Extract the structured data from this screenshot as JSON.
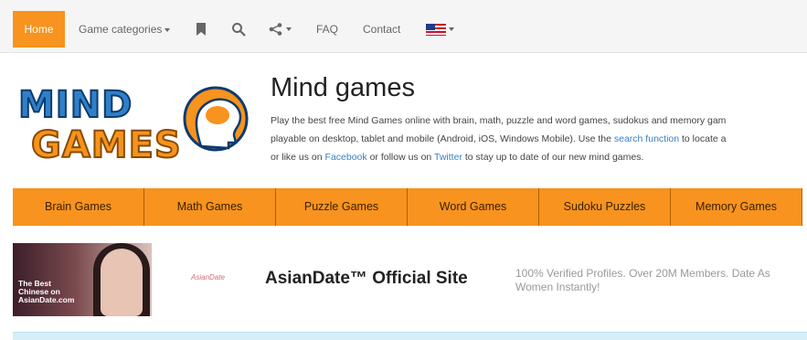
{
  "nav": {
    "home": "Home",
    "categories": "Game categories",
    "faq": "FAQ",
    "contact": "Contact",
    "icons": [
      "bookmark-icon",
      "search-icon",
      "share-icon",
      "us-flag-icon"
    ]
  },
  "logo": {
    "line1": "MIND",
    "line2": "GAMES"
  },
  "header": {
    "title": "Mind games",
    "desc_line1": "Play the best free Mind Games online with brain, math, puzzle and word games, sudokus and memory gam",
    "desc_line2_a": "playable on desktop, tablet and mobile (Android, iOS, Windows Mobile). Use the ",
    "desc_line2_link": "search function",
    "desc_line2_b": " to locate a",
    "desc_line3_a": "or like us on ",
    "desc_line3_link1": "Facebook",
    "desc_line3_b": " or follow us on ",
    "desc_line3_link2": "Twitter",
    "desc_line3_c": " to stay up to date of our new mind games."
  },
  "categories": [
    "Brain Games",
    "Math Games",
    "Puzzle Games",
    "Word Games",
    "Sudoku Puzzles",
    "Memory Games"
  ],
  "ad": {
    "caption_1": "The Best",
    "caption_2": "Chinese on",
    "caption_3": "AsianDate.com",
    "small_logo": "AsianDate",
    "title": "AsianDate™ Official Site",
    "text_1": "100% Verified Profiles. Over 20M Members. Date As",
    "text_2": "Women Instantly!"
  },
  "colors": {
    "accent": "#f7931e",
    "link": "#3a7fc4"
  }
}
